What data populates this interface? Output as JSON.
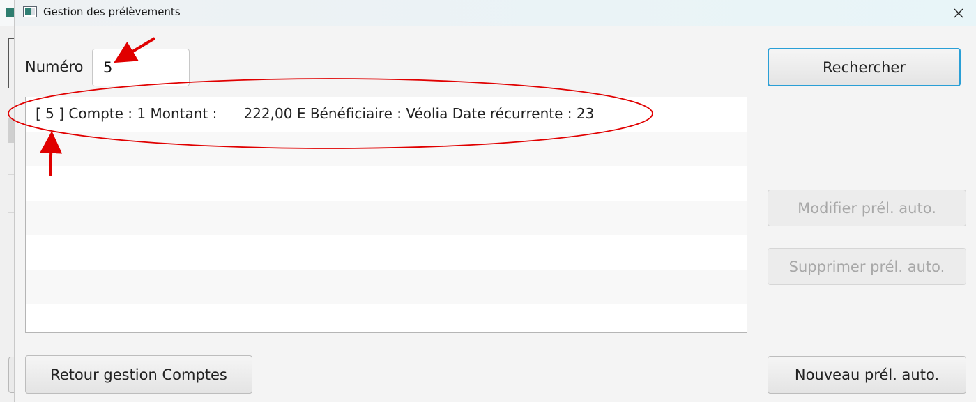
{
  "window": {
    "title": "Gestion des prélèvements",
    "close_glyph": "✕"
  },
  "search": {
    "label": "Numéro",
    "value": "5",
    "button_label": "Rechercher"
  },
  "list": {
    "items": [
      "[ 5 ] Compte : 1 Montant :      222,00 E Bénéficiaire : Véolia Date récurrente : 23"
    ]
  },
  "actions": {
    "modify_label": "Modifier prél. auto.",
    "delete_label": "Supprimer prél. auto.",
    "new_label": "Nouveau prél. auto.",
    "back_label": "Retour gestion Comptes"
  },
  "colors": {
    "focus_border": "#2a9fd6",
    "annotation": "#e00000"
  },
  "icons": {
    "app": "app-window-icon",
    "close": "close-icon"
  }
}
